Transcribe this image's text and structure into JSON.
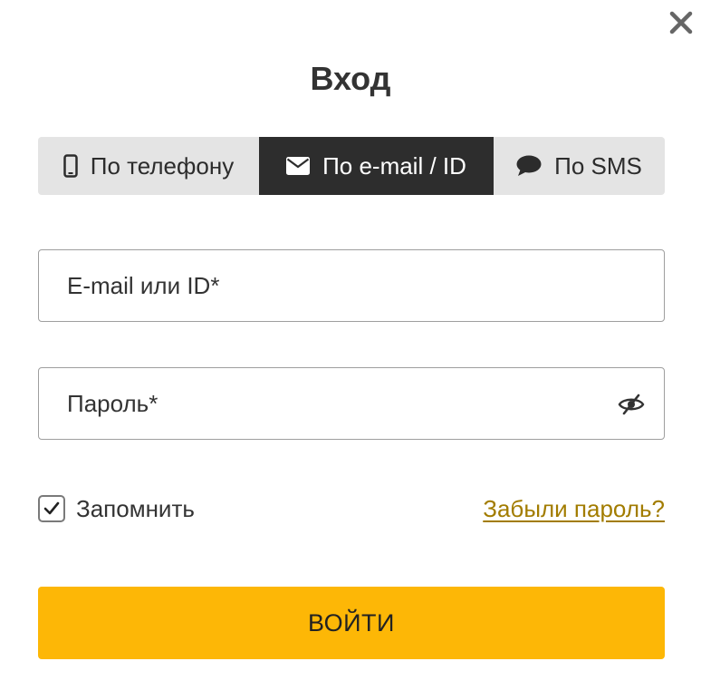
{
  "dialog": {
    "title": "Вход",
    "close_icon": "close-icon"
  },
  "tabs": [
    {
      "label": "По телефону",
      "icon": "mobile-phone-icon",
      "active": false
    },
    {
      "label": "По e-mail / ID",
      "icon": "envelope-icon",
      "active": true
    },
    {
      "label": "По SMS",
      "icon": "chat-bubble-icon",
      "active": false
    }
  ],
  "form": {
    "email": {
      "placeholder": "E-mail или ID*",
      "value": ""
    },
    "password": {
      "placeholder": "Пароль*",
      "value": "",
      "toggle_icon": "eye-slash-icon"
    },
    "remember": {
      "label": "Запомнить",
      "checked": true
    },
    "forgot_link": "Забыли пароль?",
    "submit_label": "ВОЙТИ"
  },
  "colors": {
    "accent": "#fdb706",
    "active_tab": "#2d2d2d",
    "inactive_tab": "#e4e4e4",
    "link": "#a27c00"
  }
}
